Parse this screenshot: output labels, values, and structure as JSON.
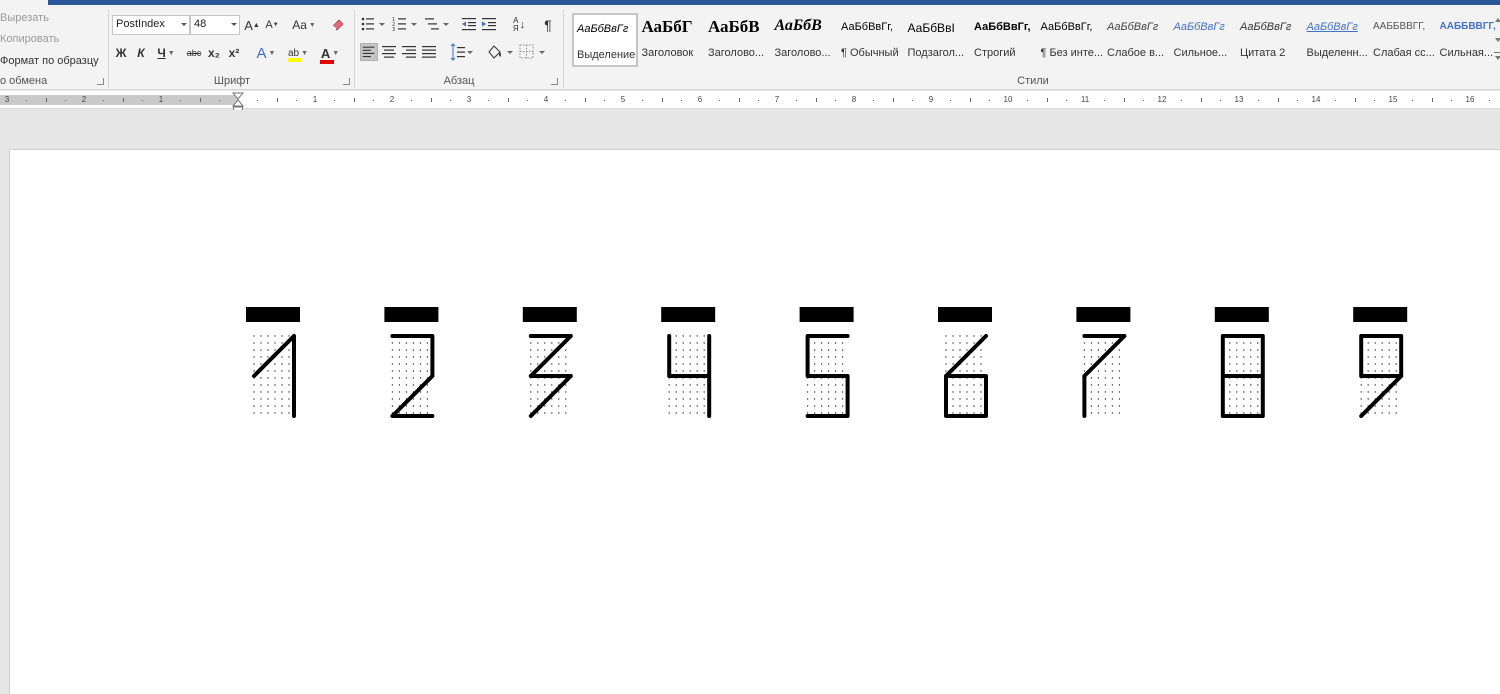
{
  "clipboard": {
    "cut_label": "Вырезать",
    "copy_label": "Копировать",
    "format_painter_label": "Формат по образцу",
    "group_label": "о обмена"
  },
  "font": {
    "name": "PostIndex",
    "size": "48",
    "grow_label": "A",
    "shrink_label": "A",
    "case_label": "Aa",
    "bold_label": "Ж",
    "italic_label": "К",
    "underline_label": "Ч",
    "strike_label": "abc",
    "sub_label": "x₂",
    "sup_label": "x²",
    "effects_label": "A",
    "highlight_label": "ab",
    "color_label": "A",
    "group_label": "Шрифт",
    "highlight_color": "#ffff00",
    "font_color": "#e00000"
  },
  "paragraph": {
    "group_label": "Абзац",
    "sort_label": "Я",
    "marks_label": "¶"
  },
  "styles": {
    "group_label": "Стили",
    "items": [
      {
        "preview": "АаБбВвГг",
        "name": "Выделение"
      },
      {
        "preview": "АаБбГ",
        "name": "Заголовок"
      },
      {
        "preview": "АаБбВ",
        "name": "Заголово..."
      },
      {
        "preview": "АаБбВ",
        "name": "Заголово..."
      },
      {
        "preview": "АаБбВвГг,",
        "name": "¶ Обычный"
      },
      {
        "preview": "АаБбВвІ",
        "name": "Подзагол..."
      },
      {
        "preview": "АаБбВвГг,",
        "name": "Строгий"
      },
      {
        "preview": "АаБбВвГг,",
        "name": "¶ Без инте..."
      },
      {
        "preview": "АаБбВвГг",
        "name": "Слабое в..."
      },
      {
        "preview": "АаБбВвГг",
        "name": "Сильное..."
      },
      {
        "preview": "АаБбВвГг",
        "name": "Цитата 2"
      },
      {
        "preview": "АаБбВвГг",
        "name": "Выделенн..."
      },
      {
        "preview": "ААББВВГГ,",
        "name": "Слабая сс..."
      },
      {
        "preview": "ААББВВГГ,",
        "name": "Сильная..."
      }
    ]
  },
  "ruler": {
    "left_numbers": [
      "3",
      "2",
      "1"
    ],
    "right_numbers": [
      "1",
      "2",
      "3",
      "4",
      "5",
      "6",
      "7",
      "8",
      "9",
      "10",
      "11",
      "12",
      "13",
      "14",
      "15",
      "16"
    ]
  },
  "document": {
    "digits": [
      "1",
      "2",
      "3",
      "4",
      "5",
      "6",
      "7",
      "8",
      "9"
    ]
  }
}
